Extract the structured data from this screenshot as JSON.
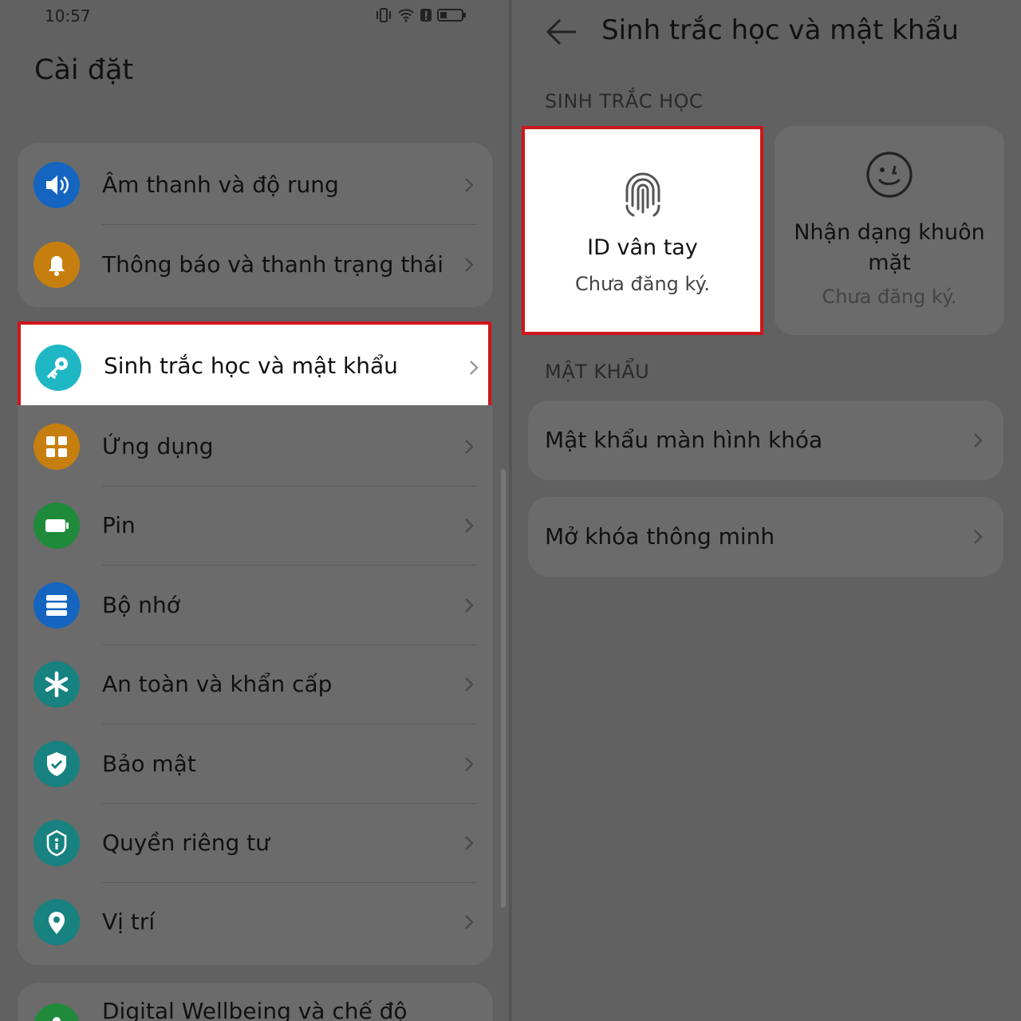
{
  "left": {
    "status": {
      "time": "10:57"
    },
    "title": "Cài đặt",
    "group1": [
      {
        "label": "Âm thanh và độ rung",
        "icon": "speaker-icon",
        "color": "#1565c0"
      },
      {
        "label": "Thông báo và thanh trạng thái",
        "icon": "bell-icon",
        "color": "#c67f0e"
      }
    ],
    "highlight": {
      "label": "Sinh trắc học và mật khẩu",
      "icon": "key-icon",
      "color": "#1fb7c4"
    },
    "group2": [
      {
        "label": "Ứng dụng",
        "icon": "apps-grid-icon",
        "color": "#c67f0e"
      },
      {
        "label": "Pin",
        "icon": "battery-icon",
        "color": "#1f8a3a"
      },
      {
        "label": "Bộ nhớ",
        "icon": "storage-icon",
        "color": "#1565c0"
      },
      {
        "label": "An toàn và khẩn cấp",
        "icon": "asterisk-icon",
        "color": "#17827f"
      },
      {
        "label": "Bảo mật",
        "icon": "shield-icon",
        "color": "#17827f"
      },
      {
        "label": "Quyền riêng tư",
        "icon": "privacy-lock-icon",
        "color": "#17827f"
      },
      {
        "label": "Vị trí",
        "icon": "location-pin-icon",
        "color": "#17827f"
      }
    ],
    "group3": [
      {
        "label": "Digital Wellbeing và chế độ",
        "icon": "wellbeing-icon",
        "color": "#1f8a3a"
      }
    ]
  },
  "right": {
    "title": "Sinh trắc học và mật khẩu",
    "section_biometric": "SINH TRẮC HỌC",
    "fingerprint": {
      "name": "ID vân tay",
      "status": "Chưa đăng ký."
    },
    "face": {
      "name_line1": "Nhận dạng khuôn",
      "name_line2": "mặt",
      "status": "Chưa đăng ký."
    },
    "section_password": "MẬT KHẨU",
    "password_items": [
      {
        "label": "Mật khẩu màn hình khóa"
      },
      {
        "label": "Mở khóa thông minh"
      }
    ]
  },
  "colors": {
    "highlight_border": "#d0151c",
    "overlay": "#616161"
  }
}
